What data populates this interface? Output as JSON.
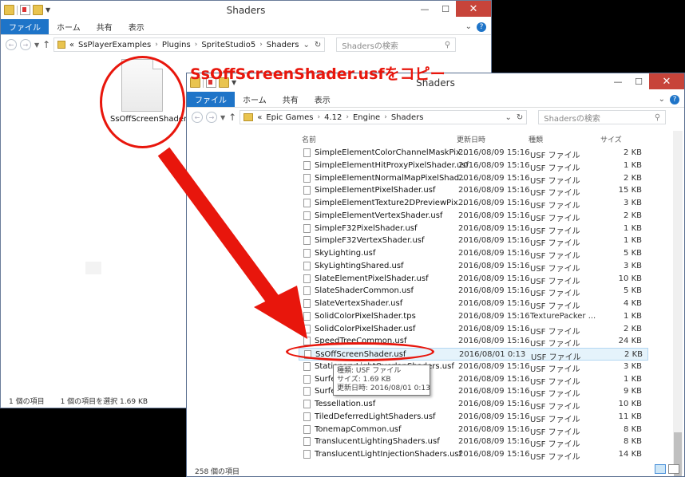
{
  "back_window": {
    "title": "Shaders",
    "ribbon": {
      "file": "ファイル",
      "home": "ホーム",
      "share": "共有",
      "view": "表示"
    },
    "address": {
      "prefix": "«",
      "crumbs": [
        "SsPlayerExamples",
        "Plugins",
        "SpriteStudio5",
        "Shaders"
      ]
    },
    "search_placeholder": "Shadersの検索",
    "file": {
      "name": "SsOffScreenShader.usf"
    },
    "status": {
      "count": "1 個の項目",
      "selected": "1 個の項目を選択  1.69 KB"
    }
  },
  "front_window": {
    "title": "Shaders",
    "ribbon": {
      "file": "ファイル",
      "home": "ホーム",
      "share": "共有",
      "view": "表示"
    },
    "address": {
      "prefix": "«",
      "crumbs": [
        "Epic Games",
        "4.12",
        "Engine",
        "Shaders"
      ]
    },
    "search_placeholder": "Shadersの検索",
    "columns": {
      "name": "名前",
      "date": "更新日時",
      "type": "種類",
      "size": "サイズ"
    },
    "files": [
      {
        "name": "SimpleElementColorChannelMaskPix...",
        "date": "2016/08/09 15:16",
        "type": "USF ファイル",
        "size": "2 KB"
      },
      {
        "name": "SimpleElementHitProxyPixelShader.usf",
        "date": "2016/08/09 15:16",
        "type": "USF ファイル",
        "size": "1 KB"
      },
      {
        "name": "SimpleElementNormalMapPixelShad...",
        "date": "2016/08/09 15:16",
        "type": "USF ファイル",
        "size": "2 KB"
      },
      {
        "name": "SimpleElementPixelShader.usf",
        "date": "2016/08/09 15:16",
        "type": "USF ファイル",
        "size": "15 KB"
      },
      {
        "name": "SimpleElementTexture2DPreviewPix...",
        "date": "2016/08/09 15:16",
        "type": "USF ファイル",
        "size": "3 KB"
      },
      {
        "name": "SimpleElementVertexShader.usf",
        "date": "2016/08/09 15:16",
        "type": "USF ファイル",
        "size": "2 KB"
      },
      {
        "name": "SimpleF32PixelShader.usf",
        "date": "2016/08/09 15:16",
        "type": "USF ファイル",
        "size": "1 KB"
      },
      {
        "name": "SimpleF32VertexShader.usf",
        "date": "2016/08/09 15:16",
        "type": "USF ファイル",
        "size": "1 KB"
      },
      {
        "name": "SkyLighting.usf",
        "date": "2016/08/09 15:16",
        "type": "USF ファイル",
        "size": "5 KB"
      },
      {
        "name": "SkyLightingShared.usf",
        "date": "2016/08/09 15:16",
        "type": "USF ファイル",
        "size": "3 KB"
      },
      {
        "name": "SlateElementPixelShader.usf",
        "date": "2016/08/09 15:16",
        "type": "USF ファイル",
        "size": "10 KB"
      },
      {
        "name": "SlateShaderCommon.usf",
        "date": "2016/08/09 15:16",
        "type": "USF ファイル",
        "size": "5 KB"
      },
      {
        "name": "SlateVertexShader.usf",
        "date": "2016/08/09 15:16",
        "type": "USF ファイル",
        "size": "4 KB"
      },
      {
        "name": "SolidColorPixelShader.tps",
        "date": "2016/08/09 15:16",
        "type": "TexturePacker ...",
        "size": "1 KB"
      },
      {
        "name": "SolidColorPixelShader.usf",
        "date": "2016/08/09 15:16",
        "type": "USF ファイル",
        "size": "2 KB"
      },
      {
        "name": "SpeedTreeCommon.usf",
        "date": "2016/08/09 15:16",
        "type": "USF ファイル",
        "size": "24 KB"
      },
      {
        "name": "SsOffScreenShader.usf",
        "date": "2016/08/01 0:13",
        "type": "USF ファイル",
        "size": "2 KB"
      },
      {
        "name": "StationaryLightOverlapShaders.usf",
        "date": "2016/08/09 15:16",
        "type": "USF ファイル",
        "size": "3 KB"
      },
      {
        "name": "Surfe",
        "date": "2016/08/09 15:16",
        "type": "USF ファイル",
        "size": "1 KB"
      },
      {
        "name": "Surfe",
        "date": "2016/08/09 15:16",
        "type": "USF ファイル",
        "size": "9 KB"
      },
      {
        "name": "Tessellation.usf",
        "date": "2016/08/09 15:16",
        "type": "USF ファイル",
        "size": "10 KB"
      },
      {
        "name": "TiledDeferredLightShaders.usf",
        "date": "2016/08/09 15:16",
        "type": "USF ファイル",
        "size": "11 KB"
      },
      {
        "name": "TonemapCommon.usf",
        "date": "2016/08/09 15:16",
        "type": "USF ファイル",
        "size": "8 KB"
      },
      {
        "name": "TranslucentLightingShaders.usf",
        "date": "2016/08/09 15:16",
        "type": "USF ファイル",
        "size": "8 KB"
      },
      {
        "name": "TranslucentLightInjectionShaders.usf",
        "date": "2016/08/09 15:16",
        "type": "USF ファイル",
        "size": "14 KB"
      }
    ],
    "tooltip": [
      "種類: USF ファイル",
      "サイズ: 1.69 KB",
      "更新日時: 2016/08/01 0:13"
    ],
    "status": {
      "count": "258 個の項目"
    }
  },
  "annotation": {
    "text": "SsOffScreenShader.usfをコピー",
    "color": "#e8160c"
  },
  "colors": {
    "accent": "#1e74c8",
    "close": "#c7443a",
    "selection": "#e5f3fb"
  }
}
